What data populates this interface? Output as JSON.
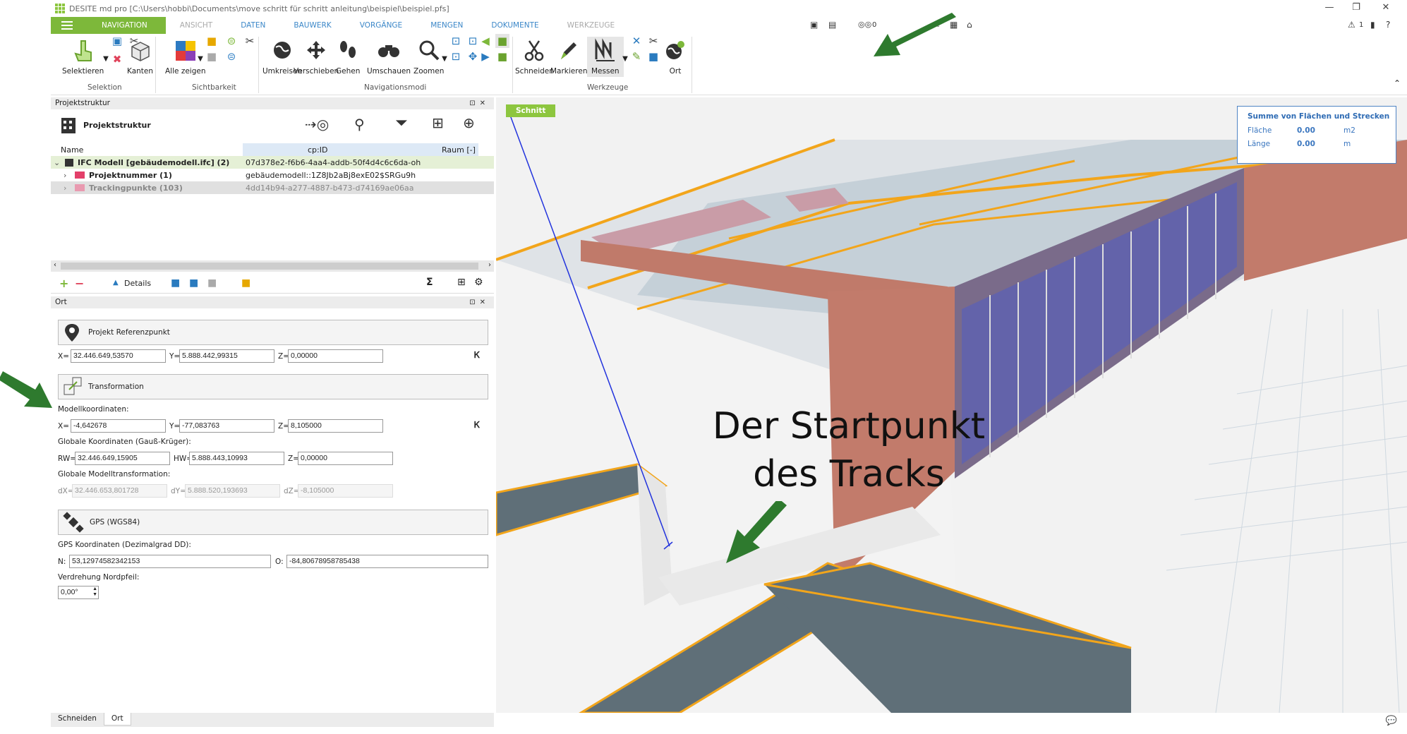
{
  "titlebar": {
    "title": "DESITE md pro [C:\\Users\\hobbi\\Documents\\move schritt für schritt anleitung\\beispiel\\beispiel.pfs]",
    "min": "—",
    "restore": "❐",
    "close": "✕"
  },
  "tabs": {
    "navigation": "NAVIGATION",
    "ansicht": "ANSICHT",
    "daten": "DATEN",
    "bauwerk": "BAUWERK",
    "vorgaenge": "VORGÄNGE",
    "mengen": "MENGEN",
    "dokumente": "DOKUMENTE",
    "werkzeuge": "WERKZEUGE",
    "count_left": "0",
    "count_right": "1"
  },
  "ribbon": {
    "selektieren": "Selektieren",
    "kanten": "Kanten",
    "alle_zeigen": "Alle zeigen",
    "umkreisen": "Umkreisen",
    "verschieben": "Verschieben",
    "gehen": "Gehen",
    "umschauen": "Umschauen",
    "zoomen": "Zoomen",
    "schneiden": "Schneiden",
    "markieren": "Markieren",
    "messen": "Messen",
    "ort": "Ort",
    "group_selektion": "Selektion",
    "group_sichtbarkeit": "Sichtbarkeit",
    "group_navigationsmodi": "Navigationsmodi",
    "group_werkzeuge": "Werkzeuge"
  },
  "projektstruktur": {
    "panel_title": "Projektstruktur",
    "toolbar_title": "Projektstruktur",
    "columns": [
      "Name",
      "cp:ID",
      "Raum [-]"
    ],
    "rows": [
      {
        "name": "IFC Modell [gebäudemodell.ifc] (2)",
        "id": "07d378e2-f6b6-4aa4-addb-50f4d4c6c6da-oh"
      },
      {
        "name": "Projektnummer (1)",
        "id": "gebäudemodell::1Z8Jb2aBj8exE02$SRGu9h"
      },
      {
        "name": "Trackingpunkte (103)",
        "id": "4dd14b94-a277-4887-b473-d74169ae06aa"
      }
    ],
    "details_label": "Details",
    "sigma": "Σ"
  },
  "ort": {
    "panel_title": "Ort",
    "referenzpunkt_label": "Projekt Referenzpunkt",
    "ref_x_label": "X=",
    "ref_x": "32.446.649,53570",
    "ref_y_label": "Y=",
    "ref_y": "5.888.442,99315",
    "ref_z_label": "Z=",
    "ref_z": "0,00000",
    "transformation_label": "Transformation",
    "modell_label": "Modellkoordinaten:",
    "mod_x_label": "X=",
    "mod_x": "-4,642678",
    "mod_y_label": "Y=",
    "mod_y": "-77,083763",
    "mod_z_label": "Z=",
    "mod_z": "8,105000",
    "global_label": "Globale Koordinaten (Gauß-Krüger):",
    "rw_label": "RW=",
    "rw": "32.446.649,15905",
    "hw_label": "HW=",
    "hw": "5.888.443,10993",
    "gz_label": "Z=",
    "gz": "0,00000",
    "trans_label": "Globale Modelltransformation:",
    "dx_label": "dX=",
    "dx": "32.446.653,801728",
    "dy_label": "dY=",
    "dy": "5.888.520,193693",
    "dz_label": "dZ=",
    "dz": "-8,105000",
    "gps_label": "GPS (WGS84)",
    "gps_coord_label": "GPS Koordinaten (Dezimalgrad DD):",
    "n_label": "N:",
    "n": "53,12974582342153",
    "o_label": "O:",
    "o": "-84,80678958785438",
    "nordpfeil_label": "Verdrehung Nordpfeil:",
    "nordpfeil": "0,00°"
  },
  "bottom_tabs": {
    "schneiden": "Schneiden",
    "ort": "Ort"
  },
  "viewport": {
    "schnitt": "Schnitt",
    "measure_title": "Summe von Flächen und Strecken",
    "flaeche_label": "Fläche",
    "flaeche_value": "0.00",
    "flaeche_unit": "m2",
    "laenge_label": "Länge",
    "laenge_value": "0.00",
    "laenge_unit": "m",
    "caption_line1": "Der Startpunkt",
    "caption_line2": "des Tracks"
  },
  "colors": {
    "accent": "#7db83a",
    "link": "#3b87c8",
    "arrow": "#2e7a2e",
    "orange": "#f2a51b"
  }
}
